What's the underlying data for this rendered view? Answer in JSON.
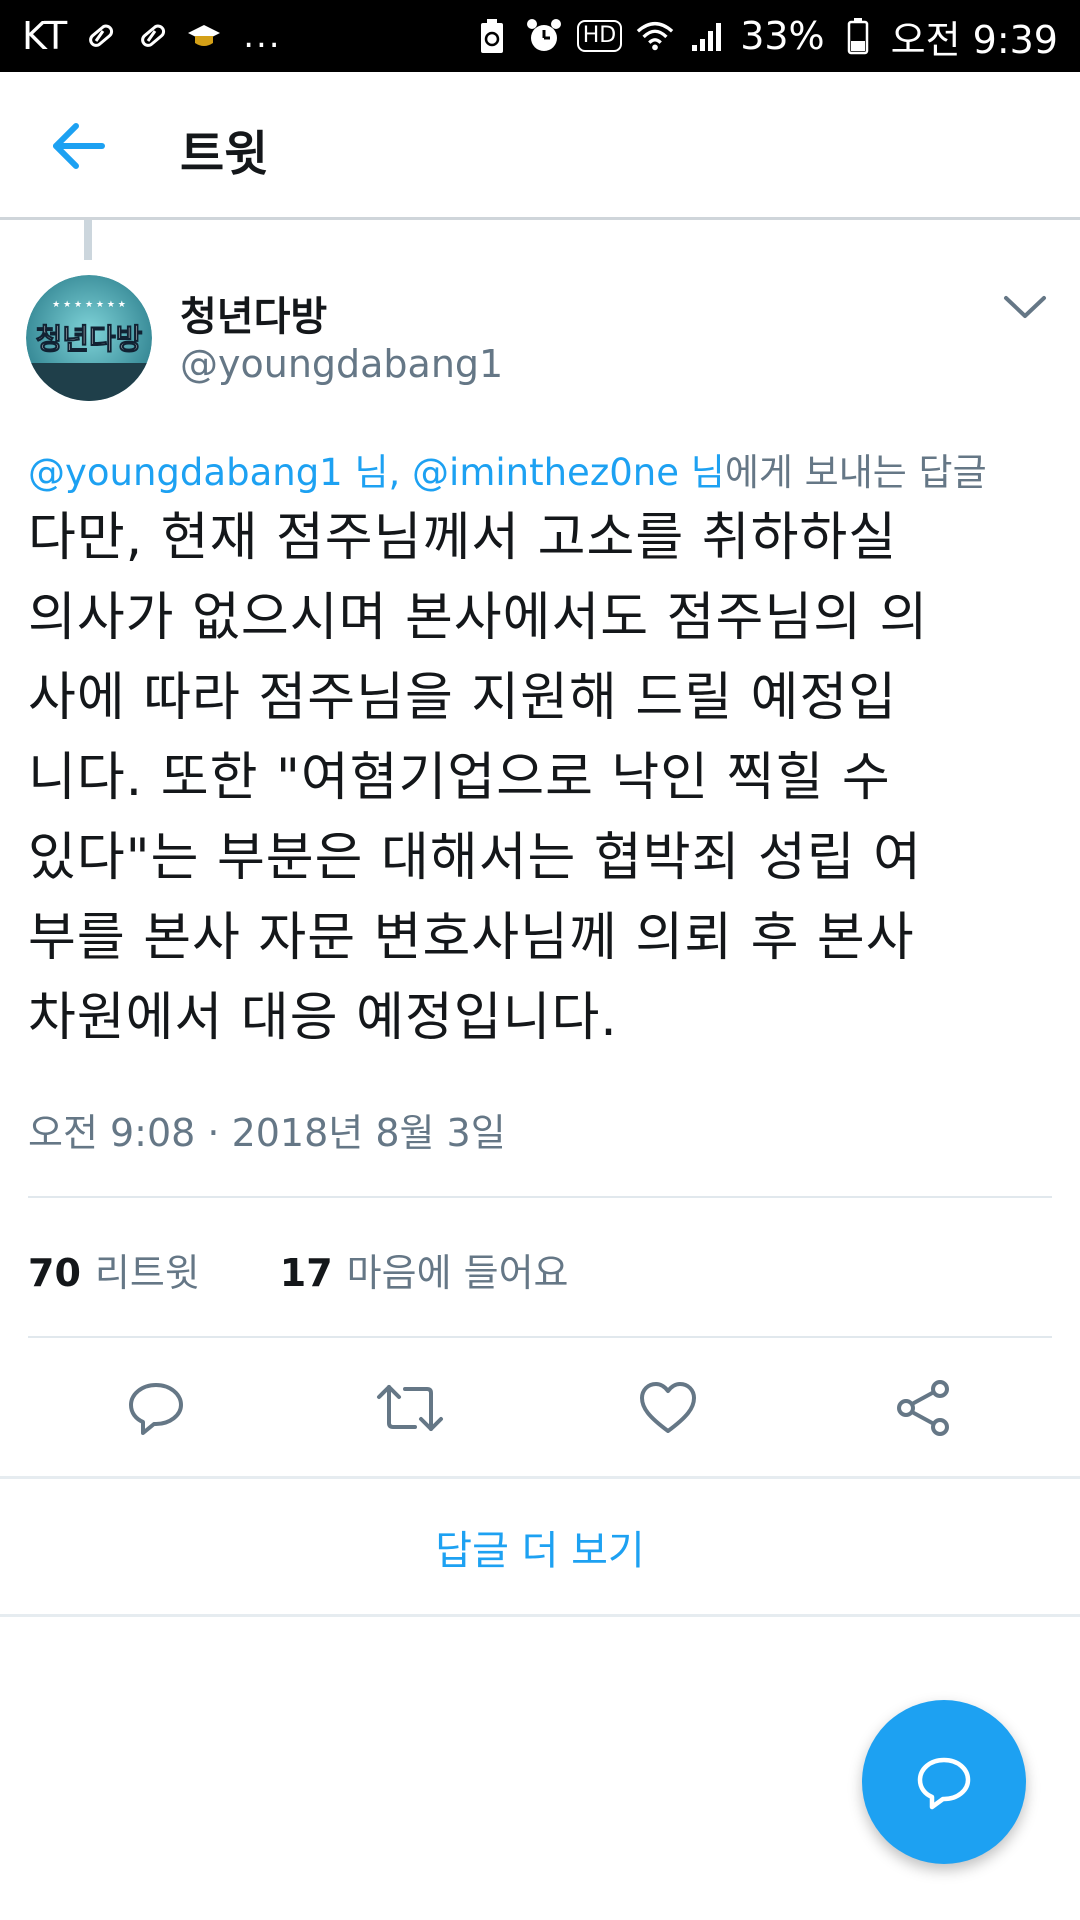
{
  "status_bar": {
    "carrier": "KT",
    "dots": "...",
    "hd": "HD",
    "battery": "33%",
    "time": "오전 9:39"
  },
  "header": {
    "title": "트윗",
    "back_icon": "arrow-left-icon"
  },
  "tweet": {
    "author": {
      "name": "청년다방",
      "handle": "@youngdabang1",
      "avatar_text": "청년다방"
    },
    "reply_to": {
      "mention1": "@youngdabang1 님,",
      "mention2": "@iminthez0ne 님",
      "suffix": "에게 보내는 답글"
    },
    "text_lines": [
      "다만, 현재 점주님께서 고소를 취하하실",
      "의사가 없으시며 본사에서도 점주님의 의",
      "사에 따라 점주님을 지원해 드릴 예정입",
      "니다. 또한 \"여혐기업으로 낙인 찍힐 수",
      "있다\"는 부분은 대해서는 협박죄 성립 여",
      "부를 본사 자문 변호사님께 의뢰 후 본사",
      "차원에서 대응 예정입니다."
    ],
    "timestamp": "오전 9:08 · 2018년 8월 3일",
    "stats": {
      "retweets_count": "70",
      "retweets_label": "리트윗",
      "likes_count": "17",
      "likes_label": "마음에 들어요"
    }
  },
  "actions": [
    "reply-icon",
    "retweet-icon",
    "heart-icon",
    "share-icon"
  ],
  "more_replies_label": "답글 더 보기",
  "colors": {
    "accent": "#1da1f2",
    "text_primary": "#14171a",
    "text_secondary": "#657786"
  }
}
